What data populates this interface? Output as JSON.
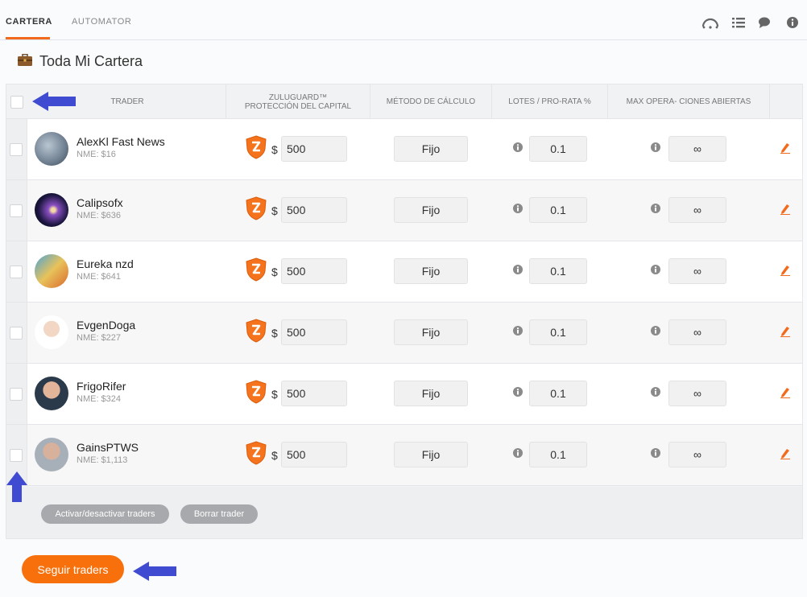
{
  "nav": {
    "tabs": [
      {
        "label": "CARTERA",
        "active": true
      },
      {
        "label": "AUTOMATOR",
        "active": false
      }
    ],
    "icons": [
      "gauge-icon",
      "list-icon",
      "chat-icon",
      "info-icon"
    ]
  },
  "page": {
    "title": "Toda Mi Cartera",
    "icon": "briefcase-icon"
  },
  "table": {
    "headers": {
      "trader": "TRADER",
      "zuluguard_line1": "ZULUGUARD™",
      "zuluguard_line2": "PROTECCIÓN DEL CAPITAL",
      "method": "MÉTODO DE CÁLCULO",
      "lots": "LOTES / PRO-RATA %",
      "maxops": "MAX OPERA- CIONES ABIERTAS"
    },
    "currency_symbol": "$",
    "rows": [
      {
        "name": "AlexKl Fast News",
        "nme": "NME: $16",
        "amount": "500",
        "method": "Fijo",
        "lots": "0.1",
        "maxops": "∞"
      },
      {
        "name": "Calipsofx",
        "nme": "NME: $636",
        "amount": "500",
        "method": "Fijo",
        "lots": "0.1",
        "maxops": "∞"
      },
      {
        "name": "Eureka nzd",
        "nme": "NME: $641",
        "amount": "500",
        "method": "Fijo",
        "lots": "0.1",
        "maxops": "∞"
      },
      {
        "name": "EvgenDoga",
        "nme": "NME: $227",
        "amount": "500",
        "method": "Fijo",
        "lots": "0.1",
        "maxops": "∞"
      },
      {
        "name": "FrigoRifer",
        "nme": "NME: $324",
        "amount": "500",
        "method": "Fijo",
        "lots": "0.1",
        "maxops": "∞"
      },
      {
        "name": "GainsPTWS",
        "nme": "NME: $1,113",
        "amount": "500",
        "method": "Fijo",
        "lots": "0.1",
        "maxops": "∞"
      }
    ]
  },
  "actions": {
    "toggle_label": "Activar/desactivar traders",
    "delete_label": "Borrar trader",
    "follow_label": "Seguir traders"
  },
  "colors": {
    "accent": "#f8700b",
    "annotation_arrow": "#3f4bd0"
  }
}
